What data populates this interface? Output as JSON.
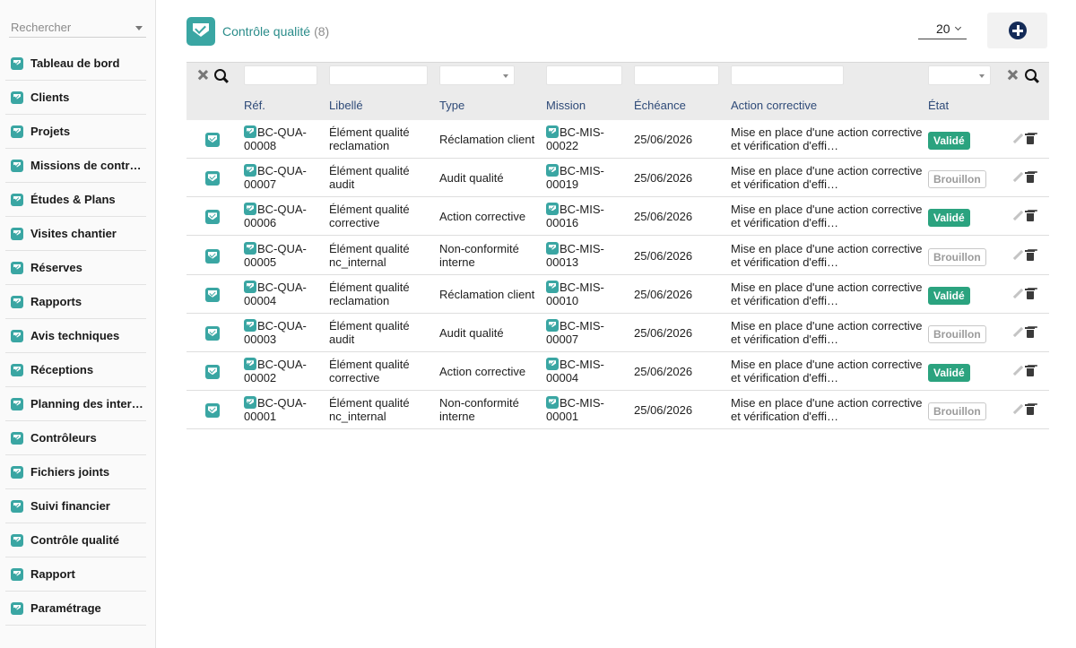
{
  "sidebar": {
    "search_placeholder": "Rechercher",
    "items": [
      {
        "label": "Tableau de bord"
      },
      {
        "label": "Clients"
      },
      {
        "label": "Projets"
      },
      {
        "label": "Missions de contrôle"
      },
      {
        "label": "Études & Plans"
      },
      {
        "label": "Visites chantier"
      },
      {
        "label": "Réserves"
      },
      {
        "label": "Rapports"
      },
      {
        "label": "Avis techniques"
      },
      {
        "label": "Réceptions"
      },
      {
        "label": "Planning des interventions"
      },
      {
        "label": "Contrôleurs"
      },
      {
        "label": "Fichiers joints"
      },
      {
        "label": "Suivi financier"
      },
      {
        "label": "Contrôle qualité"
      },
      {
        "label": "Rapport"
      },
      {
        "label": "Paramétrage"
      }
    ]
  },
  "header": {
    "title": "Contrôle qualité",
    "count": "(8)",
    "page_size": "20"
  },
  "table": {
    "columns": {
      "ref": "Réf.",
      "label": "Libellé",
      "type": "Type",
      "mission": "Mission",
      "due": "Échéance",
      "action": "Action corrective",
      "state": "État"
    },
    "rows": [
      {
        "ref1": "BC-QUA-",
        "ref2": "00008",
        "lib1": "Élément qualité",
        "lib2": "reclamation",
        "type1": "Réclamation client",
        "type2": "",
        "mis1": "BC-MIS-",
        "mis2": "00022",
        "due": "25/06/2026",
        "act1": "Mise en place d'une action corrective",
        "act2": "et vérification d'effi…",
        "state": "Validé",
        "state_kind": "ok"
      },
      {
        "ref1": "BC-QUA-",
        "ref2": "00007",
        "lib1": "Élément qualité",
        "lib2": "audit",
        "type1": "Audit qualité",
        "type2": "",
        "mis1": "BC-MIS-",
        "mis2": "00019",
        "due": "25/06/2026",
        "act1": "Mise en place d'une action corrective",
        "act2": "et vérification d'effi…",
        "state": "Brouillon",
        "state_kind": "draft"
      },
      {
        "ref1": "BC-QUA-",
        "ref2": "00006",
        "lib1": "Élément qualité",
        "lib2": "corrective",
        "type1": "Action corrective",
        "type2": "",
        "mis1": "BC-MIS-",
        "mis2": "00016",
        "due": "25/06/2026",
        "act1": "Mise en place d'une action corrective",
        "act2": "et vérification d'effi…",
        "state": "Validé",
        "state_kind": "ok"
      },
      {
        "ref1": "BC-QUA-",
        "ref2": "00005",
        "lib1": "Élément qualité",
        "lib2": "nc_internal",
        "type1": "Non-conformité",
        "type2": "interne",
        "mis1": "BC-MIS-",
        "mis2": "00013",
        "due": "25/06/2026",
        "act1": "Mise en place d'une action corrective",
        "act2": "et vérification d'effi…",
        "state": "Brouillon",
        "state_kind": "draft"
      },
      {
        "ref1": "BC-QUA-",
        "ref2": "00004",
        "lib1": "Élément qualité",
        "lib2": "reclamation",
        "type1": "Réclamation client",
        "type2": "",
        "mis1": "BC-MIS-",
        "mis2": "00010",
        "due": "25/06/2026",
        "act1": "Mise en place d'une action corrective",
        "act2": "et vérification d'effi…",
        "state": "Validé",
        "state_kind": "ok"
      },
      {
        "ref1": "BC-QUA-",
        "ref2": "00003",
        "lib1": "Élément qualité",
        "lib2": "audit",
        "type1": "Audit qualité",
        "type2": "",
        "mis1": "BC-MIS-",
        "mis2": "00007",
        "due": "25/06/2026",
        "act1": "Mise en place d'une action corrective",
        "act2": "et vérification d'effi…",
        "state": "Brouillon",
        "state_kind": "draft"
      },
      {
        "ref1": "BC-QUA-",
        "ref2": "00002",
        "lib1": "Élément qualité",
        "lib2": "corrective",
        "type1": "Action corrective",
        "type2": "",
        "mis1": "BC-MIS-",
        "mis2": "00004",
        "due": "25/06/2026",
        "act1": "Mise en place d'une action corrective",
        "act2": "et vérification d'effi…",
        "state": "Validé",
        "state_kind": "ok"
      },
      {
        "ref1": "BC-QUA-",
        "ref2": "00001",
        "lib1": "Élément qualité",
        "lib2": "nc_internal",
        "type1": "Non-conformité",
        "type2": "interne",
        "mis1": "BC-MIS-",
        "mis2": "00001",
        "due": "25/06/2026",
        "act1": "Mise en place d'une action corrective",
        "act2": "et vérification d'effi…",
        "state": "Brouillon",
        "state_kind": "draft"
      }
    ]
  },
  "icons": {
    "module": "quality-shield-icon",
    "add": "plus-circle-icon",
    "clear": "close-icon",
    "search": "search-icon",
    "edit": "pencil-icon",
    "delete": "trash-icon"
  },
  "colors": {
    "accent": "#3aa6a3",
    "title": "#2a8c8a",
    "link": "#14306b",
    "validated": "#2ba37f",
    "add_button": "#142b57"
  }
}
